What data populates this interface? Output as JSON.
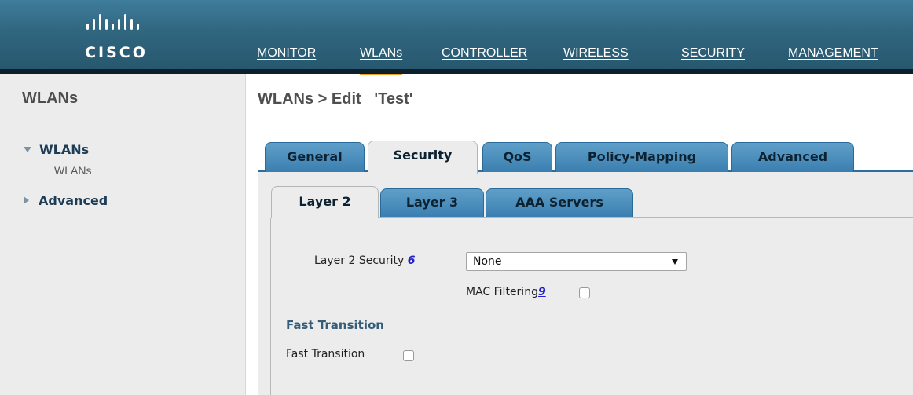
{
  "header": {
    "logo_text": "CISCO",
    "nav": [
      {
        "label": "MONITOR",
        "active": false
      },
      {
        "label": "WLANs",
        "active": true
      },
      {
        "label": "CONTROLLER",
        "active": false
      },
      {
        "label": "WIRELESS",
        "active": false
      },
      {
        "label": "SECURITY",
        "active": false
      },
      {
        "label": "MANAGEMENT",
        "active": false
      }
    ],
    "accent_color": "#f39c1f"
  },
  "sidebar": {
    "title": "WLANs",
    "items": [
      {
        "label": "WLANs",
        "expanded": true,
        "children": [
          "WLANs"
        ]
      },
      {
        "label": "Advanced",
        "expanded": false
      }
    ]
  },
  "main": {
    "title": "WLANs > Edit   'Test'",
    "tabs": [
      {
        "label": "General",
        "active": false
      },
      {
        "label": "Security",
        "active": true
      },
      {
        "label": "QoS",
        "active": false
      },
      {
        "label": "Policy-Mapping",
        "active": false
      },
      {
        "label": "Advanced",
        "active": false
      }
    ],
    "subtabs": [
      {
        "label": "Layer 2",
        "active": true
      },
      {
        "label": "Layer 3",
        "active": false
      },
      {
        "label": "AAA Servers",
        "active": false
      }
    ],
    "layer2_security": {
      "label": "Layer 2 Security",
      "help": "6",
      "value": "None"
    },
    "mac_filtering": {
      "label": "MAC Filtering",
      "help": "9",
      "checked": false
    },
    "fast_transition": {
      "section_title": "Fast Transition",
      "label": "Fast Transition",
      "checked": false
    }
  }
}
